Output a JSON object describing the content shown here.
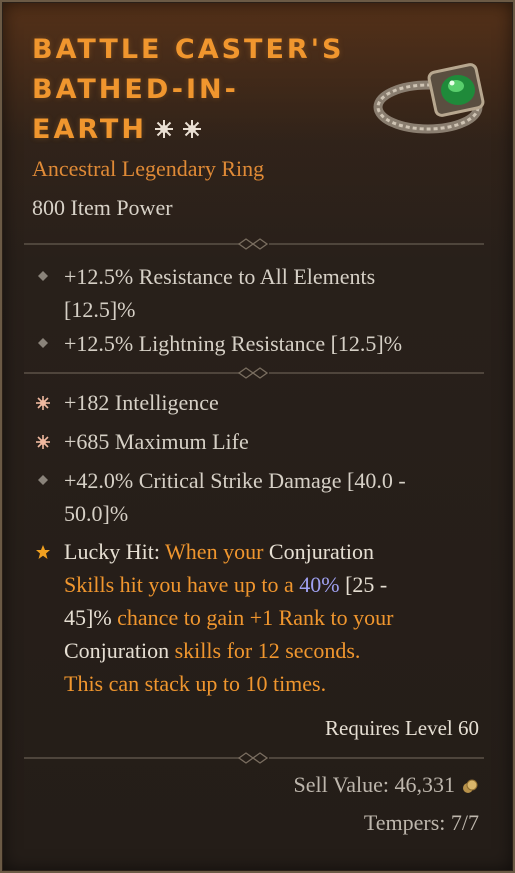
{
  "item": {
    "name_line1": "Battle Caster's",
    "name_line2": "Bathed-in-",
    "name_line3": "Earth",
    "type": "Ancestral Legendary Ring",
    "item_power": "800 Item Power"
  },
  "implicits": [
    {
      "line1": "+12.5% Resistance to All Elements",
      "line2": "[12.5]%"
    },
    {
      "line1": "+12.5% Lightning Resistance [12.5]%"
    }
  ],
  "affixes": [
    {
      "text": "+182 Intelligence",
      "icon": "greater-affix-icon"
    },
    {
      "text": "+685 Maximum Life",
      "icon": "greater-affix-icon"
    },
    {
      "line1": "+42.0% Critical Strike Damage [40.0 -",
      "line2": "50.0]%",
      "icon": "diamond-bullet-icon"
    }
  ],
  "legendary_aspect": {
    "icon": "star-icon",
    "lucky_hit": "Lucky Hit:",
    "s1": " When your ",
    "conjuration1": "Conjuration",
    "s2": "Skills hit you have up to a ",
    "pct": "40%",
    "range1": " [25 -",
    "range2": "45]%",
    "s3": " chance to gain +1 Rank to your",
    "conjuration2": "Conjuration",
    "s4": " skills for 12 seconds.",
    "s5": "This can stack up to 10 times."
  },
  "footer": {
    "requires": "Requires Level 60",
    "sell_value": "Sell Value: 46,331",
    "tempers": "Tempers: 7/7"
  },
  "colors": {
    "title_orange": "#f0962e",
    "affix_text": "#d6d0c6",
    "highlight_blue": "#9fa0f0",
    "border": "#6b5a45"
  }
}
